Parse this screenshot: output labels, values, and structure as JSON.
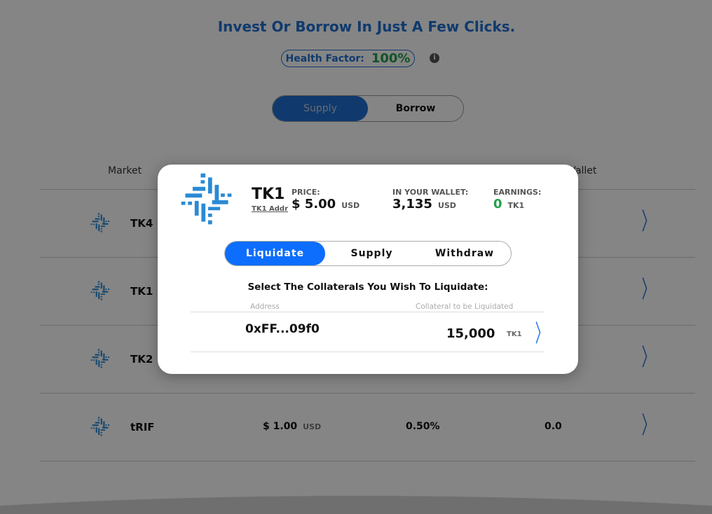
{
  "header": {
    "title": "Invest Or Borrow In Just A Few Clicks.",
    "health_label": "Health Factor:",
    "health_value": "100%",
    "info_icon": "i"
  },
  "mode_toggle": {
    "options": [
      "Supply",
      "Borrow"
    ],
    "active": "Supply"
  },
  "table": {
    "headers": {
      "market": "Market",
      "wallet": "Wallet"
    },
    "rows": [
      {
        "name": "TK4"
      },
      {
        "name": "TK1"
      },
      {
        "name": "TK2"
      },
      {
        "name": "tRIF",
        "price": "$ 1.00",
        "price_unit": "USD",
        "rate": "0.50%",
        "wallet": "0.0"
      }
    ]
  },
  "modal": {
    "token": "TK1",
    "address_link": "TK1 Addr",
    "price_label": "PRICE:",
    "price": "$ 5.00",
    "price_unit": "USD",
    "wallet_label": "IN YOUR WALLET:",
    "wallet": "3,135",
    "wallet_unit": "USD",
    "earnings_label": "EARNINGS:",
    "earnings": "0",
    "earnings_unit": "TK1",
    "tabs": [
      "Liquidate",
      "Supply",
      "Withdraw"
    ],
    "active_tab": "Liquidate",
    "instruction": "Select The Collaterals You Wish To Liquidate:",
    "columns": [
      "Address",
      "Collateral to be Liquidated"
    ],
    "rows": [
      {
        "address": "0xFF...09f0",
        "amount": "15,000",
        "unit": "TK1"
      }
    ]
  },
  "colors": {
    "brand": "#1f6fd1",
    "active_tab": "#0d6efd",
    "positive": "#22a04a",
    "logo": "#2a8ad4"
  }
}
